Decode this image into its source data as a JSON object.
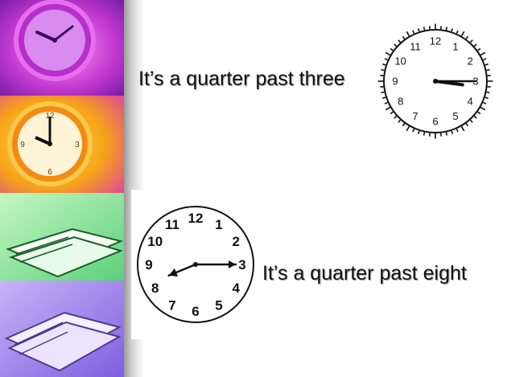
{
  "captions": {
    "first": "It’s a quarter past three",
    "second": "It’s a quarter past eight"
  },
  "clocks": {
    "first": {
      "numbers": [
        "12",
        "1",
        "2",
        "3",
        "4",
        "5",
        "6",
        "7",
        "8",
        "9",
        "10",
        "11"
      ],
      "hour": 3.25,
      "minute": 15
    },
    "second": {
      "numbers": [
        "12",
        "1",
        "2",
        "3",
        "4",
        "5",
        "6",
        "7",
        "8",
        "9",
        "10",
        "11"
      ],
      "hour": 8.25,
      "minute": 15
    }
  },
  "colors": {
    "magenta_panel": "#d23cd6",
    "orange_panel": "#f5a21a",
    "green_panel": "#7fdc86",
    "violet_panel": "#a987e8"
  }
}
